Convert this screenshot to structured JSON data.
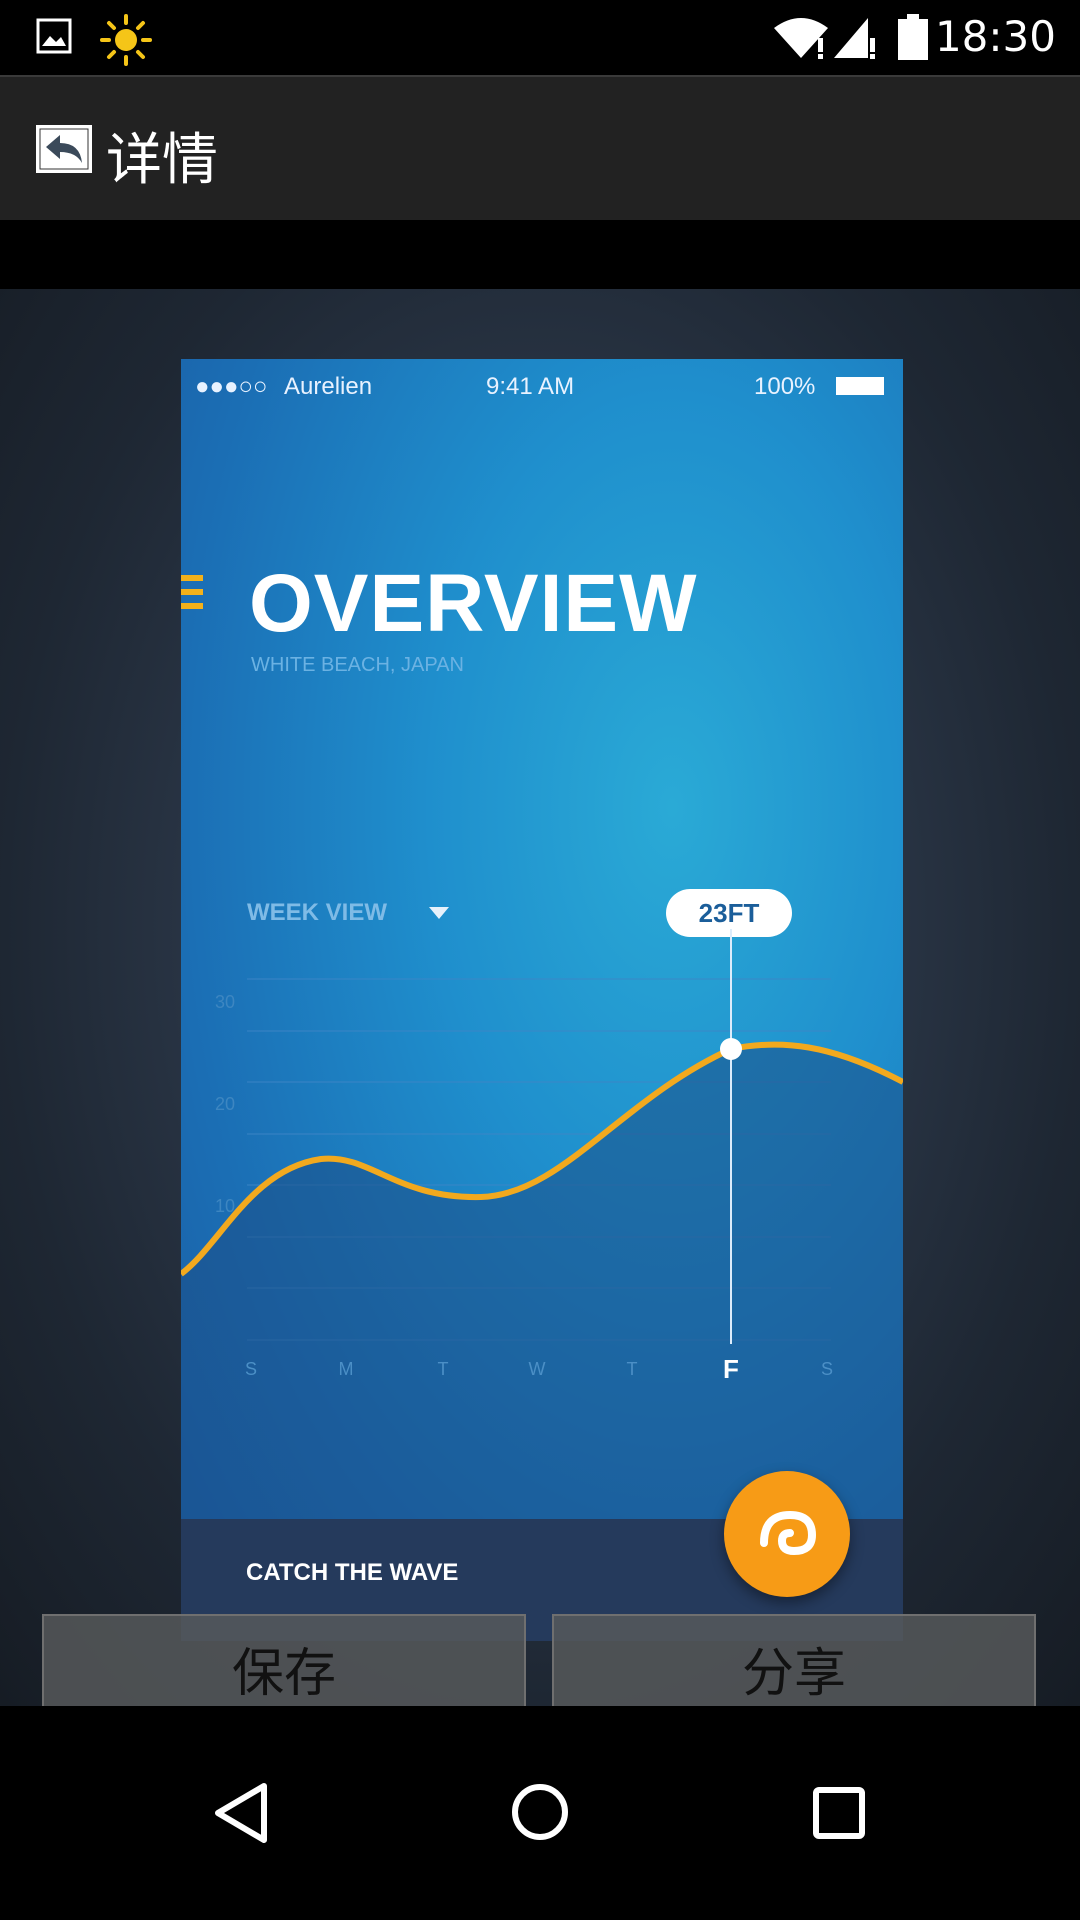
{
  "status_bar": {
    "time": "18:30"
  },
  "app_bar": {
    "title": "详情"
  },
  "image": {
    "phone_status": {
      "carrier": "Aurelien",
      "time": "9:41 AM",
      "battery": "100%"
    },
    "title": "OVERVIEW",
    "location": "WHITE BEACH, JAPAN",
    "week_view": "WEEK VIEW",
    "badge": "23FT",
    "y_axis": [
      "30",
      "20",
      "10"
    ],
    "days": [
      "S",
      "M",
      "T",
      "W",
      "T",
      "F",
      "S"
    ],
    "footer_label": "CATCH THE WAVE"
  },
  "actions": {
    "save": "保存",
    "share": "分享"
  },
  "colors": {
    "accent_orange": "#f79b16",
    "wave_line": "#f2a91e",
    "app_bar": "#222222"
  }
}
